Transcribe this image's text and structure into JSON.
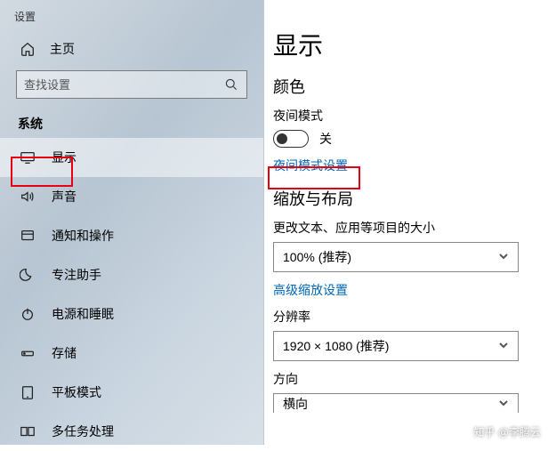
{
  "app": {
    "title": "设置"
  },
  "home": {
    "label": "主页"
  },
  "search": {
    "placeholder": "查找设置"
  },
  "section": {
    "label": "系统"
  },
  "nav": {
    "display": "显示",
    "sound": "声音",
    "notifications": "通知和操作",
    "focus": "专注助手",
    "power": "电源和睡眠",
    "storage": "存储",
    "tablet": "平板模式",
    "multitask": "多任务处理"
  },
  "main": {
    "title": "显示",
    "color_section": "颜色",
    "night_mode_label": "夜间模式",
    "toggle_off": "关",
    "night_mode_settings": "夜间模式设置",
    "scale_section": "缩放与布局",
    "scale_label": "更改文本、应用等项目的大小",
    "scale_value": "100% (推荐)",
    "advanced_scale": "高级缩放设置",
    "resolution_label": "分辨率",
    "resolution_value": "1920 × 1080 (推荐)",
    "orientation_label": "方向",
    "orientation_value": "横向"
  },
  "watermark": "知乎 @李腾云"
}
